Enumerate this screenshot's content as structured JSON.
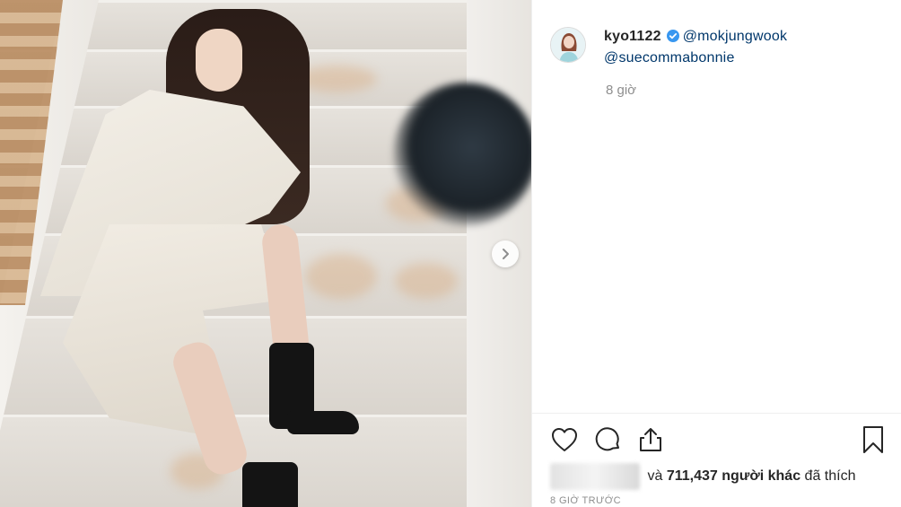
{
  "post": {
    "username": "kyo1122",
    "mentions": [
      "@mokjungwook",
      "@suecommabonnie"
    ],
    "relative_time": "8 giờ",
    "likes_prefix": "và",
    "likes_count": "711,437",
    "likes_suffix_bold": "người khác",
    "likes_suffix": "đã thích",
    "timestamp_upper": "8 GIỜ TRƯỚC"
  },
  "icons": {
    "verified": "verified-badge-icon",
    "like": "heart-icon",
    "comment": "comment-bubble-icon",
    "share": "share-icon",
    "save": "bookmark-icon",
    "next": "chevron-right-icon"
  },
  "colors": {
    "verified": "#3897f0",
    "mention": "#00376b",
    "muted": "#8e8e8e"
  }
}
